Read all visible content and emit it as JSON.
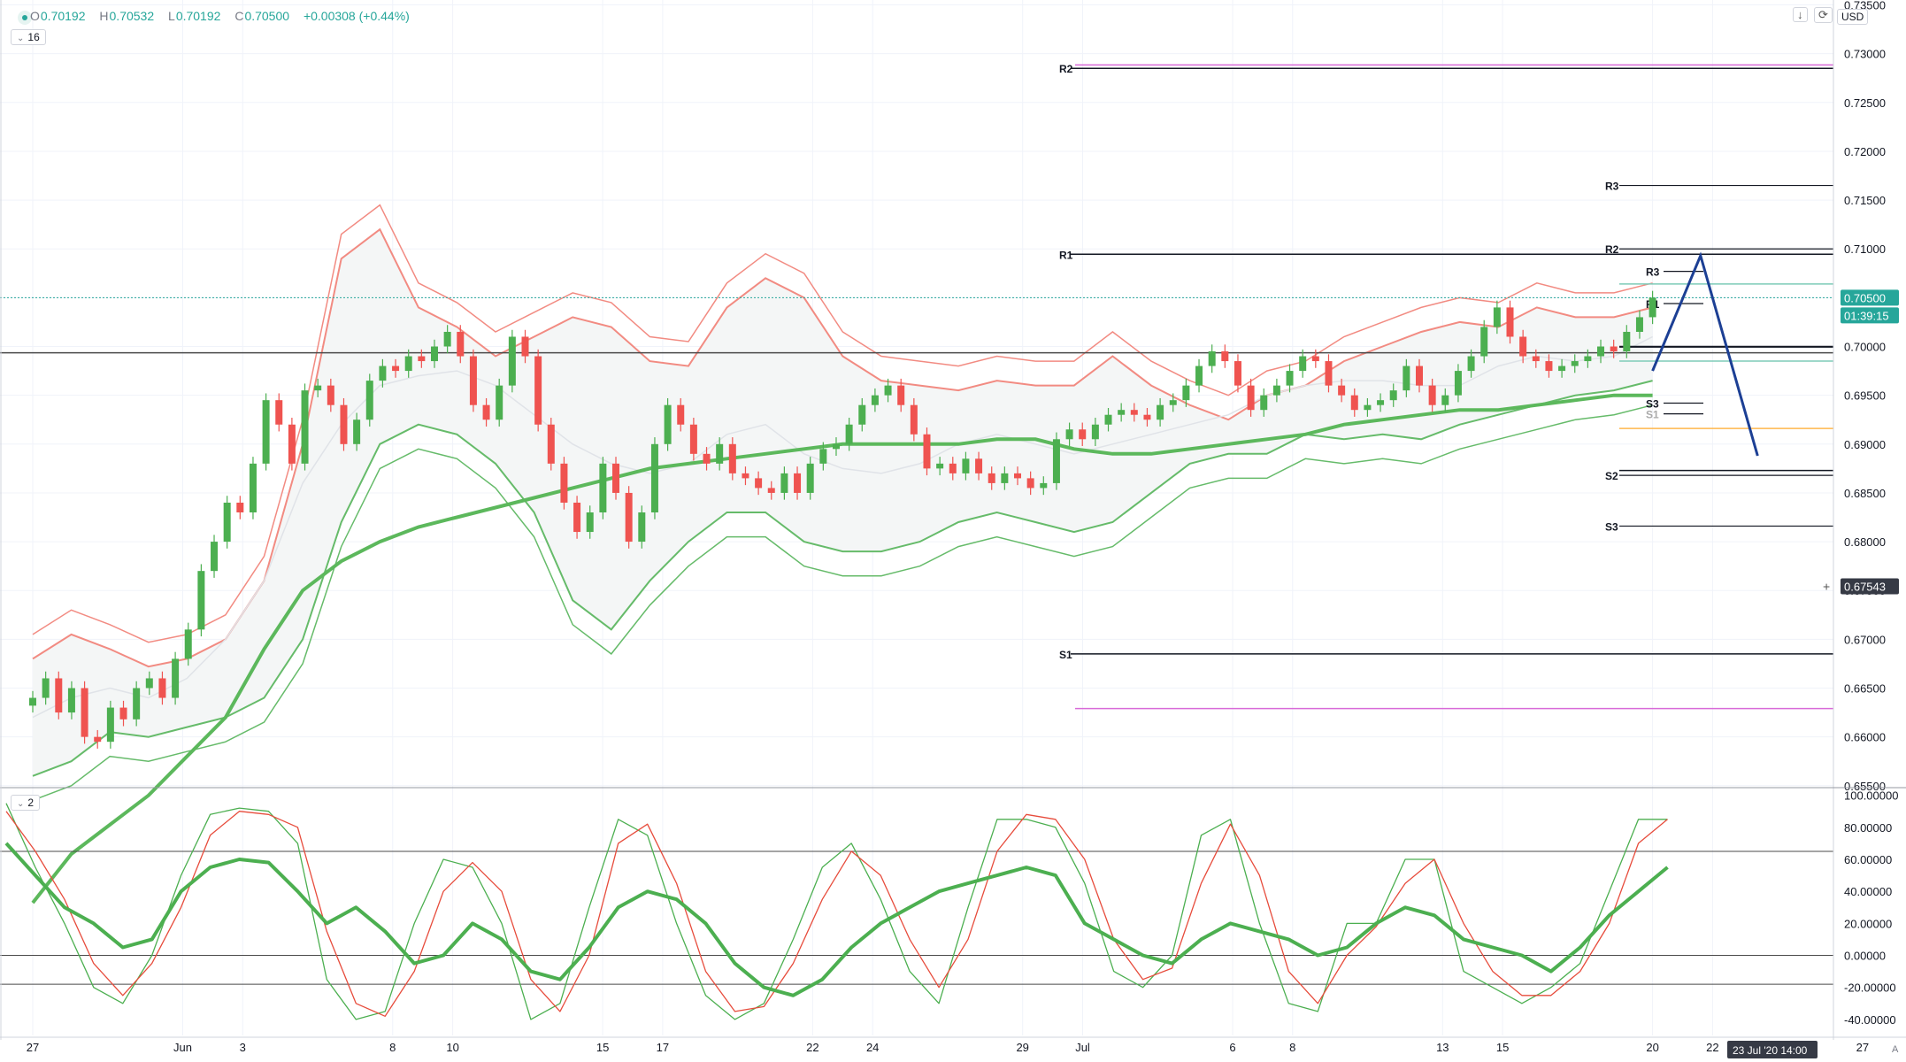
{
  "header": {
    "o_label": "O",
    "o_value": "0.70192",
    "h_label": "H",
    "h_value": "0.70532",
    "l_label": "L",
    "l_value": "0.70192",
    "c_label": "C",
    "c_value": "0.70500",
    "change": "+0.00308 (+0.44%)",
    "interval_value": "16",
    "currency": "USD",
    "oscillator_value": "2",
    "auto_label": "A",
    "icons": [
      "chevron-down-icon",
      "arrow-down-icon",
      "refresh-icon"
    ]
  },
  "colors": {
    "bull": "#4caf50",
    "bear": "#ef5350",
    "band_red": "#f28b82",
    "band_green": "#66bb6a",
    "ma_green": "#5cb85c",
    "ma_red": "#ef7070",
    "arrow": "#1c3f94",
    "osc_fast": "#4caf50",
    "osc_slow": "#e74c3c",
    "pivot_magenta": "#d86ad8",
    "pivot_orange": "#ffb74d",
    "pivot_teal": "#7ecbb8",
    "price_tag": "#26a69a"
  },
  "chart_data": [
    {
      "type": "candlestick",
      "instrument_currency": "USD",
      "y_ticks": [
        "0.73500",
        "0.73000",
        "0.72500",
        "0.72000",
        "0.71500",
        "0.71000",
        "0.70500",
        "0.70000",
        "0.69500",
        "0.69000",
        "0.68500",
        "0.68000",
        "0.67500",
        "0.67000",
        "0.66500",
        "0.66000",
        "0.65500"
      ],
      "y_range": [
        0.6548,
        0.7355
      ],
      "x_ticks": [
        "27",
        "Jun",
        "3",
        "8",
        "10",
        "15",
        "17",
        "22",
        "24",
        "29",
        "Jul",
        "6",
        "8",
        "13",
        "15",
        "20",
        "22"
      ],
      "x_tick_last": "27",
      "x_range_days": [
        0,
        57
      ],
      "x_tick_days": [
        0,
        5,
        7,
        12,
        14,
        19,
        21,
        26,
        28,
        33,
        35,
        40,
        42,
        47,
        49,
        54,
        56
      ],
      "x_tick_last_day": 61,
      "last_price": "0.70500",
      "countdown": "01:39:15",
      "crosshair_price": "0.67543",
      "crosshair_time": "23 Jul '20   14:00",
      "horizontal_line": 0.69935,
      "pivot_levels_monthly": [
        {
          "label": "R2",
          "value": 0.7285
        },
        {
          "label": "R1",
          "value": 0.70945
        },
        {
          "label": "S1",
          "value": 0.6685
        }
      ],
      "pivot_extra_lines": [
        {
          "value": 0.72885,
          "color": "magenta"
        },
        {
          "value": 0.6629,
          "color": "magenta"
        },
        {
          "value": 0.69995,
          "color": "dark"
        },
        {
          "value": 0.6873,
          "color": "dark"
        }
      ],
      "pivot_levels_weekly": [
        {
          "label": "R3",
          "value": 0.7165
        },
        {
          "label": "R2",
          "value": 0.71
        },
        {
          "label": "S2",
          "value": 0.6868
        },
        {
          "label": "S3",
          "value": 0.6816
        }
      ],
      "pivot_levels_daily": [
        {
          "label": "R3",
          "value": 0.7077
        },
        {
          "label": "R1",
          "value": 0.7044
        },
        {
          "label": "S3",
          "value": 0.6942
        },
        {
          "label": "S1",
          "value": 0.6931
        }
      ],
      "pivot_daily_other": [
        0.7064,
        0.7,
        0.6985,
        0.6916
      ],
      "projection": {
        "points": [
          [
            54.0,
            0.6975
          ],
          [
            55.6,
            0.7093
          ],
          [
            57.5,
            0.6888
          ]
        ]
      },
      "candles_from_day": 0,
      "candles_per_day": 1.5,
      "closes": [
        0.664,
        0.666,
        0.6625,
        0.665,
        0.66,
        0.6595,
        0.663,
        0.6618,
        0.665,
        0.666,
        0.664,
        0.668,
        0.671,
        0.677,
        0.68,
        0.684,
        0.683,
        0.688,
        0.6945,
        0.692,
        0.688,
        0.6955,
        0.696,
        0.694,
        0.69,
        0.6925,
        0.6965,
        0.698,
        0.6975,
        0.699,
        0.6985,
        0.7,
        0.7015,
        0.699,
        0.694,
        0.6925,
        0.696,
        0.701,
        0.699,
        0.692,
        0.688,
        0.684,
        0.681,
        0.683,
        0.688,
        0.685,
        0.68,
        0.683,
        0.69,
        0.694,
        0.692,
        0.689,
        0.688,
        0.69,
        0.687,
        0.6865,
        0.6855,
        0.685,
        0.687,
        0.685,
        0.688,
        0.6895,
        0.69,
        0.692,
        0.694,
        0.695,
        0.696,
        0.694,
        0.691,
        0.6875,
        0.688,
        0.687,
        0.6885,
        0.687,
        0.686,
        0.687,
        0.6865,
        0.6855,
        0.686,
        0.6905,
        0.6915,
        0.6905,
        0.692,
        0.693,
        0.6935,
        0.693,
        0.6925,
        0.694,
        0.6945,
        0.696,
        0.698,
        0.6995,
        0.6985,
        0.696,
        0.6935,
        0.695,
        0.696,
        0.6975,
        0.699,
        0.6985,
        0.696,
        0.695,
        0.6935,
        0.694,
        0.6945,
        0.6955,
        0.698,
        0.696,
        0.694,
        0.695,
        0.6975,
        0.699,
        0.702,
        0.704,
        0.701,
        0.699,
        0.6985,
        0.6975,
        0.698,
        0.6985,
        0.699,
        0.7,
        0.6995,
        0.7015,
        0.703,
        0.705
      ],
      "bb_upper": [
        0.668,
        0.6705,
        0.669,
        0.6672,
        0.668,
        0.67,
        0.676,
        0.69,
        0.709,
        0.712,
        0.704,
        0.702,
        0.699,
        0.701,
        0.703,
        0.702,
        0.6985,
        0.698,
        0.704,
        0.707,
        0.705,
        0.699,
        0.6965,
        0.696,
        0.6955,
        0.6965,
        0.696,
        0.696,
        0.699,
        0.696,
        0.694,
        0.6925,
        0.695,
        0.696,
        0.6985,
        0.7,
        0.7015,
        0.7025,
        0.702,
        0.704,
        0.703,
        0.703,
        0.704
      ],
      "bb_mid": [
        0.662,
        0.664,
        0.665,
        0.664,
        0.666,
        0.67,
        0.676,
        0.686,
        0.692,
        0.696,
        0.697,
        0.6975,
        0.696,
        0.693,
        0.69,
        0.688,
        0.687,
        0.688,
        0.691,
        0.692,
        0.689,
        0.6875,
        0.687,
        0.688,
        0.69,
        0.691,
        0.69,
        0.689,
        0.69,
        0.691,
        0.692,
        0.693,
        0.695,
        0.696,
        0.6965,
        0.6965,
        0.696,
        0.696,
        0.698,
        0.699,
        0.6985,
        0.699,
        0.701
      ],
      "bb_lower": [
        0.656,
        0.6575,
        0.6605,
        0.66,
        0.661,
        0.662,
        0.664,
        0.67,
        0.682,
        0.69,
        0.692,
        0.691,
        0.688,
        0.683,
        0.674,
        0.671,
        0.676,
        0.68,
        0.683,
        0.683,
        0.68,
        0.679,
        0.679,
        0.68,
        0.682,
        0.683,
        0.682,
        0.681,
        0.682,
        0.685,
        0.688,
        0.689,
        0.689,
        0.691,
        0.6905,
        0.691,
        0.6905,
        0.692,
        0.693,
        0.694,
        0.695,
        0.6955,
        0.6965
      ],
      "ma_long": [
        0.643,
        0.648,
        0.651,
        0.654,
        0.658,
        0.662,
        0.669,
        0.675,
        0.678,
        0.68,
        0.6815,
        0.6825,
        0.6835,
        0.6845,
        0.6855,
        0.6865,
        0.6875,
        0.688,
        0.6885,
        0.689,
        0.6895,
        0.69,
        0.69,
        0.69,
        0.69,
        0.6905,
        0.6905,
        0.6895,
        0.689,
        0.689,
        0.6895,
        0.69,
        0.6905,
        0.691,
        0.692,
        0.6925,
        0.693,
        0.6935,
        0.6935,
        0.694,
        0.6945,
        0.695,
        0.695
      ]
    },
    {
      "type": "line",
      "name": "",
      "y_ticks": [
        "100.00000",
        "80.00000",
        "60.00000",
        "40.00000",
        "20.00000",
        "0.00000",
        "-20.00000",
        "-40.00000"
      ],
      "y_range": [
        -50,
        102
      ],
      "levels": [
        65,
        0,
        -18
      ],
      "series": [
        {
          "name": "",
          "values": [
            95,
            55,
            20,
            -20,
            -30,
            0,
            50,
            88,
            92,
            90,
            70,
            -15,
            -40,
            -35,
            20,
            60,
            55,
            20,
            -40,
            -30,
            30,
            85,
            75,
            20,
            -25,
            -40,
            -30,
            10,
            55,
            70,
            35,
            -10,
            -30,
            30,
            85,
            85,
            80,
            45,
            -10,
            -20,
            0,
            75,
            85,
            20,
            -30,
            -35,
            20,
            20,
            60,
            60,
            -10,
            -20,
            -30,
            -20,
            -5,
            40,
            85,
            85
          ]
        },
        {
          "name": "",
          "values": [
            90,
            65,
            35,
            -5,
            -25,
            -5,
            30,
            75,
            90,
            88,
            80,
            15,
            -30,
            -38,
            -10,
            40,
            58,
            40,
            -15,
            -35,
            0,
            70,
            82,
            45,
            -10,
            -35,
            -32,
            -5,
            35,
            65,
            50,
            10,
            -20,
            10,
            65,
            88,
            85,
            60,
            10,
            -15,
            -8,
            45,
            82,
            50,
            -10,
            -30,
            0,
            18,
            45,
            60,
            20,
            -10,
            -25,
            -25,
            -10,
            20,
            70,
            85
          ]
        },
        {
          "name": "",
          "values": [
            70,
            50,
            30,
            20,
            5,
            10,
            40,
            55,
            60,
            58,
            40,
            20,
            30,
            15,
            -5,
            0,
            20,
            10,
            -10,
            -15,
            5,
            30,
            40,
            35,
            20,
            -5,
            -20,
            -25,
            -15,
            5,
            20,
            30,
            40,
            45,
            50,
            55,
            50,
            20,
            10,
            0,
            -5,
            10,
            20,
            15,
            10,
            0,
            5,
            20,
            30,
            25,
            10,
            5,
            0,
            -10,
            5,
            25,
            40,
            55
          ]
        }
      ]
    }
  ]
}
